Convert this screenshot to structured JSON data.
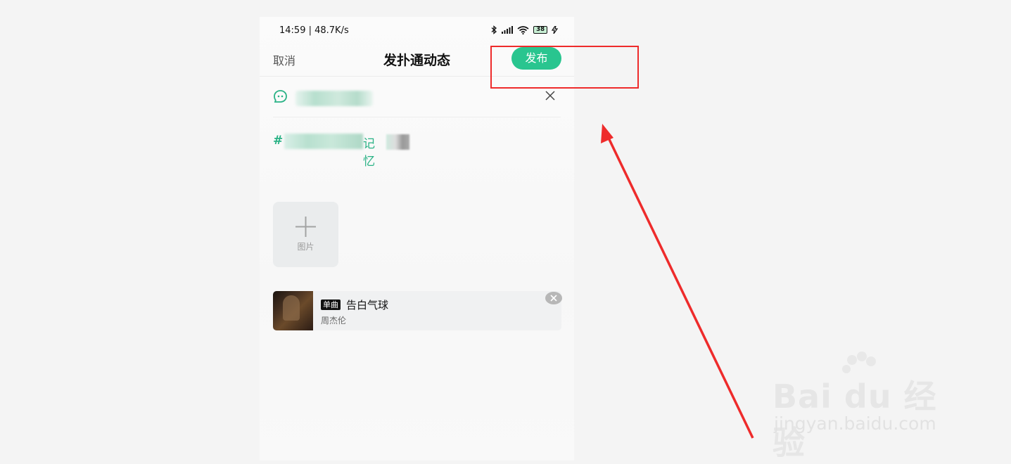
{
  "status_bar": {
    "time_speed": "14:59 | 48.7K/s",
    "battery": "38"
  },
  "nav": {
    "cancel": "取消",
    "title": "发扑通动态",
    "publish": "发布"
  },
  "post": {
    "hash": "#",
    "visible_fragment": "记忆"
  },
  "add_image": {
    "label": "图片"
  },
  "music": {
    "badge": "单曲",
    "title": "告白气球",
    "artist": "周杰伦"
  },
  "colors": {
    "accent": "#29c58f",
    "annotation": "#ee2b2b"
  },
  "watermark": {
    "logo": "Bai du 经验",
    "url": "jingyan.baidu.com"
  }
}
